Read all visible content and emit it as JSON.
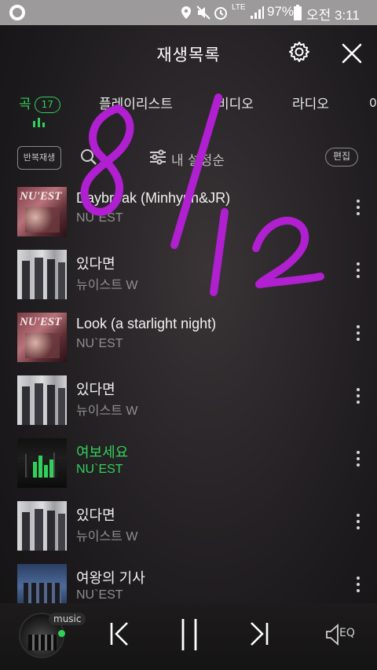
{
  "status_bar": {
    "battery": "97%",
    "time": "오전 3:11",
    "network": "LTE"
  },
  "header": {
    "title": "재생목록"
  },
  "tabs": [
    {
      "label": "곡",
      "count": "17",
      "active": true
    },
    {
      "label": "플레이리스트"
    },
    {
      "label": "비디오"
    },
    {
      "label": "라디오"
    },
    {
      "label": "아"
    }
  ],
  "toolbar": {
    "repeat_label": "반복재생",
    "sort_label": "내 설정순",
    "edit_label": "편집"
  },
  "songs": [
    {
      "title": "Daybreak (Minhyun&JR)",
      "artist": "NU`EST",
      "playing": false
    },
    {
      "title": "있다면",
      "artist": "뉴이스트 W",
      "playing": false
    },
    {
      "title": "Look (a starlight night)",
      "artist": "NU`EST",
      "playing": false
    },
    {
      "title": "있다면",
      "artist": "뉴이스트 W",
      "playing": false
    },
    {
      "title": "여보세요",
      "artist": "NU`EST",
      "playing": true
    },
    {
      "title": "있다면",
      "artist": "뉴이스트 W",
      "playing": false
    },
    {
      "title": "여왕의 기사",
      "artist": "NU`EST",
      "playing": false
    }
  ],
  "player": {
    "source_tag": "music",
    "eq_label": "EQ"
  },
  "annotation": {
    "text": "8/12",
    "color": "#b01fd0"
  },
  "colors": {
    "accent": "#31d05b",
    "background": "#1e1c1e"
  }
}
